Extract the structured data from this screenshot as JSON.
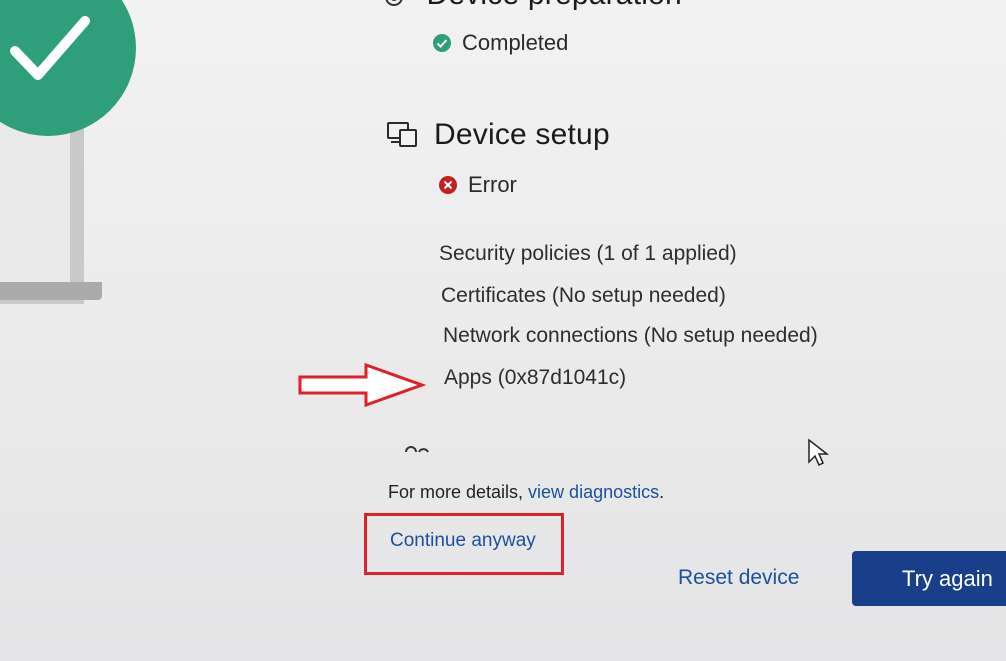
{
  "device_preparation": {
    "title": "Device preparation",
    "status": "Completed",
    "status_color": "#2f9e7a"
  },
  "device_setup": {
    "title": "Device setup",
    "status": "Error",
    "status_color": "#c0211f",
    "items": [
      "Security policies (1 of 1 applied)",
      "Certificates (No setup needed)",
      "Network connections (No setup needed)",
      "Apps (0x87d1041c)"
    ]
  },
  "footer": {
    "details_prefix": "For more details, ",
    "view_diagnostics": "view diagnostics",
    "details_suffix": ".",
    "continue_anyway": "Continue anyway",
    "reset_device": "Reset device",
    "try_again": "Try again"
  },
  "colors": {
    "accent": "#1a3f8a",
    "link": "#1c4f9c",
    "annotation_red": "#e0202a"
  }
}
